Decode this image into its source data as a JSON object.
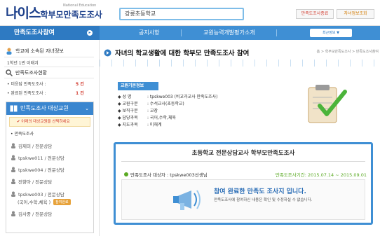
{
  "header": {
    "logo_big": "나이스",
    "logo_small": "학부모만족도조사",
    "logo_sub": "National Education",
    "school": "강릉초등학교",
    "btn_survey": "만족도조사종료",
    "btn_info": "자녀정보조회"
  },
  "nav": {
    "left_label": "만족도조사참여",
    "items": [
      "공지사항",
      "교원능력개발평가소개"
    ],
    "mini_label": "최근정보 ▼",
    "colors": {
      "bar": "#3f8fd4",
      "left": "#2e7ac2"
    }
  },
  "sidebar": {
    "child_title": "학교에 소속된 자녀정보",
    "child_class": "1학년 1반 이태겨",
    "survey_status_title": "만족도조사현황",
    "stats": [
      {
        "label": "• 미응답 만족도조사 :",
        "count": "5 건"
      },
      {
        "label": "• 완료된 만족도조사 :",
        "count": "1 건"
      }
    ],
    "panel_title": "만족도조사 대상교원",
    "warn": "✔ 아래의 대상교원을 선택하세요",
    "selected": "• 만족도조사",
    "counsel_list": [
      {
        "name": "김제미 / 전문상담"
      },
      {
        "name": "tpskwe011 / 전문상담"
      },
      {
        "name": "tpskwe004 / 전문상담"
      },
      {
        "name": "전향아 / 전문상담"
      },
      {
        "name": "tpskwe003 / 전문상담",
        "sub": "(국어,수학,체육 )",
        "badge": "참여완료"
      },
      {
        "name": "김사중 / 전문상담"
      }
    ]
  },
  "main": {
    "title": "자녀의 학교생활에 대한 학부모 만족도조사 참여",
    "breadcrumb": "홈 > 학부모만족도조사 > 만족도조사참여",
    "info_label": "교원기본정보",
    "info_rows": [
      {
        "k": "◆ 성    명",
        "v": ": tpskwe003 (비교과교사 만족도조사)"
      },
      {
        "k": "◆ 교원구분",
        "v": ": 수석교사(초등학교)"
      },
      {
        "k": "◆ 보직구분",
        "v": ": 교장"
      },
      {
        "k": "◆ 담당과목",
        "v": ": 국어,수학,체육"
      },
      {
        "k": "◆ 지도과목",
        "v": ": 미해계"
      }
    ],
    "survey_title": "초등학교 전문상담교사 학부모만족도조사",
    "target": "만족도조사 대상자 : tpskwe003선생님",
    "period": "만족도조사기간: 2015.07.14 ~ 2015.09.01",
    "done_title": "참여 완료한 만족도 조사지 입니다.",
    "done_sub": "만족도조사에 참여하신 내용은 확인 및 수정하실 수 없습니다."
  }
}
